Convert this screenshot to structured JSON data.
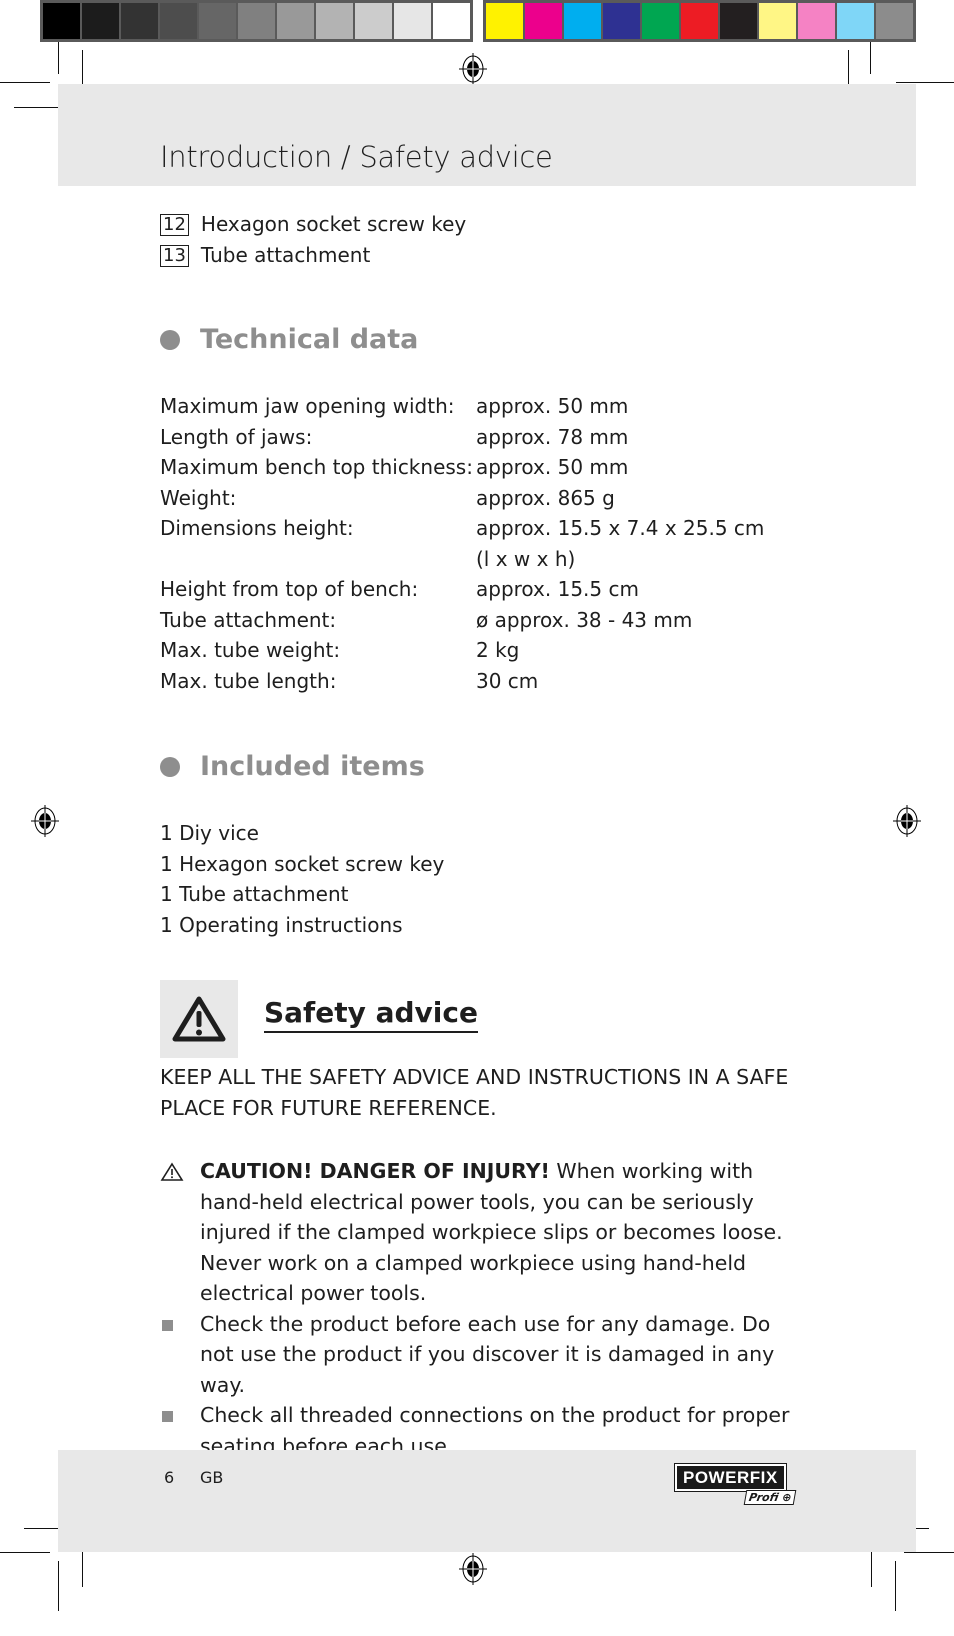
{
  "print_marks": {
    "grayscale_swatches": [
      "#000000",
      "#1c1c1c",
      "#333333",
      "#4d4d4d",
      "#666666",
      "#808080",
      "#999999",
      "#b3b3b3",
      "#cccccc",
      "#e6e6e6",
      "#ffffff"
    ],
    "color_swatches": [
      "#fff200",
      "#ec008c",
      "#00aeef",
      "#2e3192",
      "#00a651",
      "#ed1c24",
      "#231f20",
      "#fff685",
      "#f582c4",
      "#7fd6f7",
      "#8c8c8c"
    ]
  },
  "header": {
    "title": "Introduction / Safety advice"
  },
  "parts": [
    {
      "number": "12",
      "label": "Hexagon socket screw key"
    },
    {
      "number": "13",
      "label": "Tube attachment"
    }
  ],
  "technical_data": {
    "heading": "Technical data",
    "rows": [
      {
        "label": "Maximum jaw opening width:",
        "value": "approx. 50 mm"
      },
      {
        "label": "Length of jaws:",
        "value": "approx. 78 mm"
      },
      {
        "label": "Maximum bench top thickness:",
        "value": "approx. 50 mm"
      },
      {
        "label": "Weight:",
        "value": "approx. 865 g"
      },
      {
        "label": "Dimensions height:",
        "value": "approx. 15.5 x 7.4 x 25.5 cm"
      },
      {
        "label": "",
        "value": "(l x w x h)"
      },
      {
        "label": "Height from top of bench:",
        "value": "approx. 15.5 cm"
      },
      {
        "label": "Tube attachment:",
        "value": "ø approx. 38 - 43 mm"
      },
      {
        "label": "Max. tube weight:",
        "value": "2 kg"
      },
      {
        "label": "Max. tube length:",
        "value": "30 cm"
      }
    ]
  },
  "included_items": {
    "heading": "Included items",
    "items": [
      "1 Diy vice",
      "1 Hexagon socket screw key",
      "1 Tube attachment",
      "1 Operating instructions"
    ]
  },
  "safety": {
    "heading": "Safety advice",
    "keep_notice": "KEEP ALL THE SAFETY ADVICE AND INSTRUCTIONS IN A SAFE PLACE FOR FUTURE REFERENCE.",
    "caution_label": "CAUTION! DANGER OF INJURY!",
    "caution_text": " When working with hand-held electrical power tools, you can be seriously injured if the clamped workpiece slips or becomes loose. Never work on a clamped workpiece using hand-held electrical power tools.",
    "bullets": [
      "Check the product before each use for any damage. Do not use the product if you discover it is damaged in any way.",
      "Check all threaded connections on the product for proper seating before each use."
    ]
  },
  "footer": {
    "page_number": "6",
    "language": "GB",
    "brand": "POWERFIX",
    "brand_sub": "Profi"
  }
}
